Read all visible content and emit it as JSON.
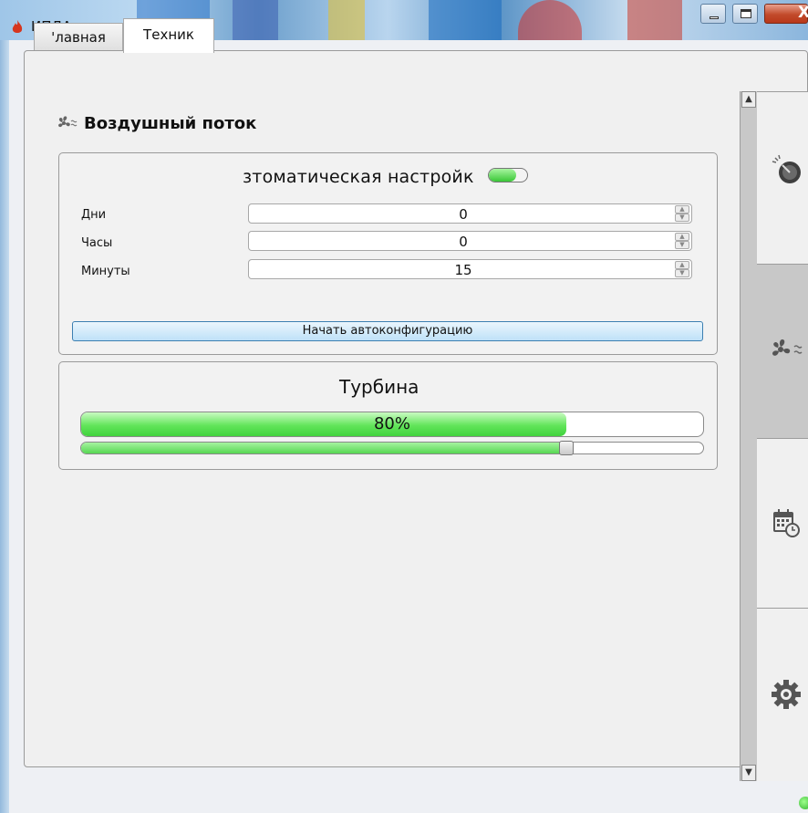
{
  "window": {
    "title": "ИПДА",
    "controls": {
      "minimize": "minimize",
      "maximize": "maximize",
      "close": "X"
    }
  },
  "tabs": [
    {
      "label": "Главная",
      "display": "'лавная",
      "active": false
    },
    {
      "label": "Техник",
      "active": true
    }
  ],
  "section": {
    "title": "Воздушный поток",
    "icon": "fan-airflow-icon"
  },
  "auto_config": {
    "label": "зтоматическая настройк",
    "toggle_on": true,
    "fields": [
      {
        "label": "Дни",
        "value": "0"
      },
      {
        "label": "Часы",
        "value": "0"
      },
      {
        "label": "Минуты",
        "value": "15"
      }
    ],
    "start_button": "Начать автоконфигурацию"
  },
  "turbine": {
    "label": "Турбина",
    "progress_text": "80%",
    "progress_fraction": 0.78,
    "slider_fraction": 0.78
  },
  "side_nav": [
    {
      "icon": "gauge-icon",
      "active": false
    },
    {
      "icon": "fan-airflow-icon",
      "active": true
    },
    {
      "icon": "calendar-clock-icon",
      "active": false
    },
    {
      "icon": "gear-icon",
      "active": false
    }
  ],
  "colors": {
    "accent_green": "#3fd23c",
    "button_blue": "#bfe1f8",
    "active_nav": "#c8c8c8"
  }
}
